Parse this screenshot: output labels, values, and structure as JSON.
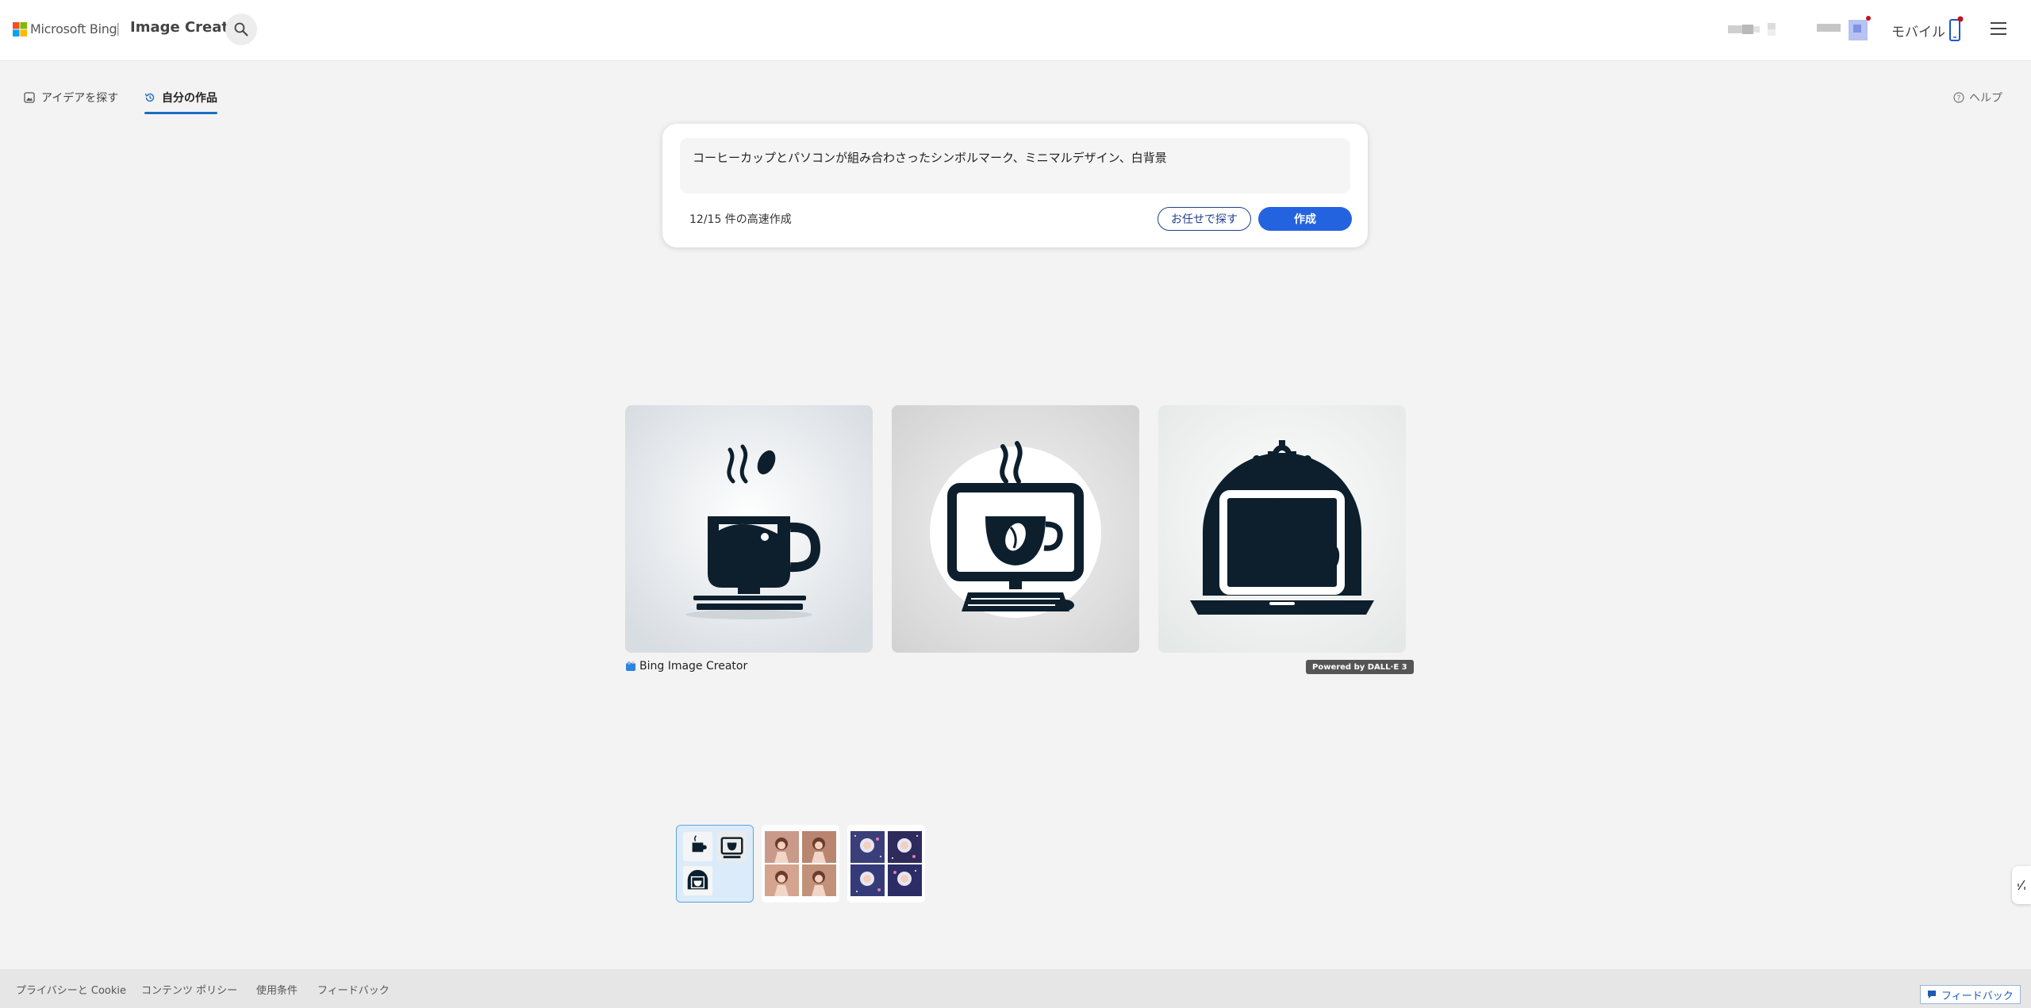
{
  "header": {
    "brand": "Microsoft Bing",
    "separator": "|",
    "app_title": "Image Creator",
    "mobile_label": "モバイル",
    "notification_color": "#c50f1f"
  },
  "tabs": [
    {
      "label": "アイデアを探す",
      "active": false
    },
    {
      "label": "自分の作品",
      "active": true
    }
  ],
  "help_label": "ヘルプ",
  "prompt": {
    "value": "コーヒーカップとパソコンが組み合わさったシンボルマーク、ミニマルデザイン、白背景",
    "counter": "12/15 件の高速作成",
    "surprise_label": "お任せで探す",
    "create_label": "作成"
  },
  "results": {
    "caption": "Bing Image Creator",
    "badge": "Powered by DALL·E 3",
    "images": [
      {
        "icon": "coffee-cup-on-keyboard-icon"
      },
      {
        "icon": "coffee-cup-in-monitor-icon"
      },
      {
        "icon": "laptop-with-coffee-icon"
      }
    ]
  },
  "history": [
    {
      "name": "coffee-symbol-set",
      "selected": true
    },
    {
      "name": "anime-girl-set",
      "selected": false
    },
    {
      "name": "space-girl-set",
      "selected": false
    }
  ],
  "footer": {
    "links": [
      "プライバシーと Cookie",
      "コンテンツ ポリシー",
      "使用条件",
      "フィードバック"
    ],
    "feedback_button": "フィードバック"
  },
  "colors": {
    "accent": "#2463e0",
    "tab_underline": "#1b6ec2",
    "icon_dark": "#0d1f2d"
  }
}
